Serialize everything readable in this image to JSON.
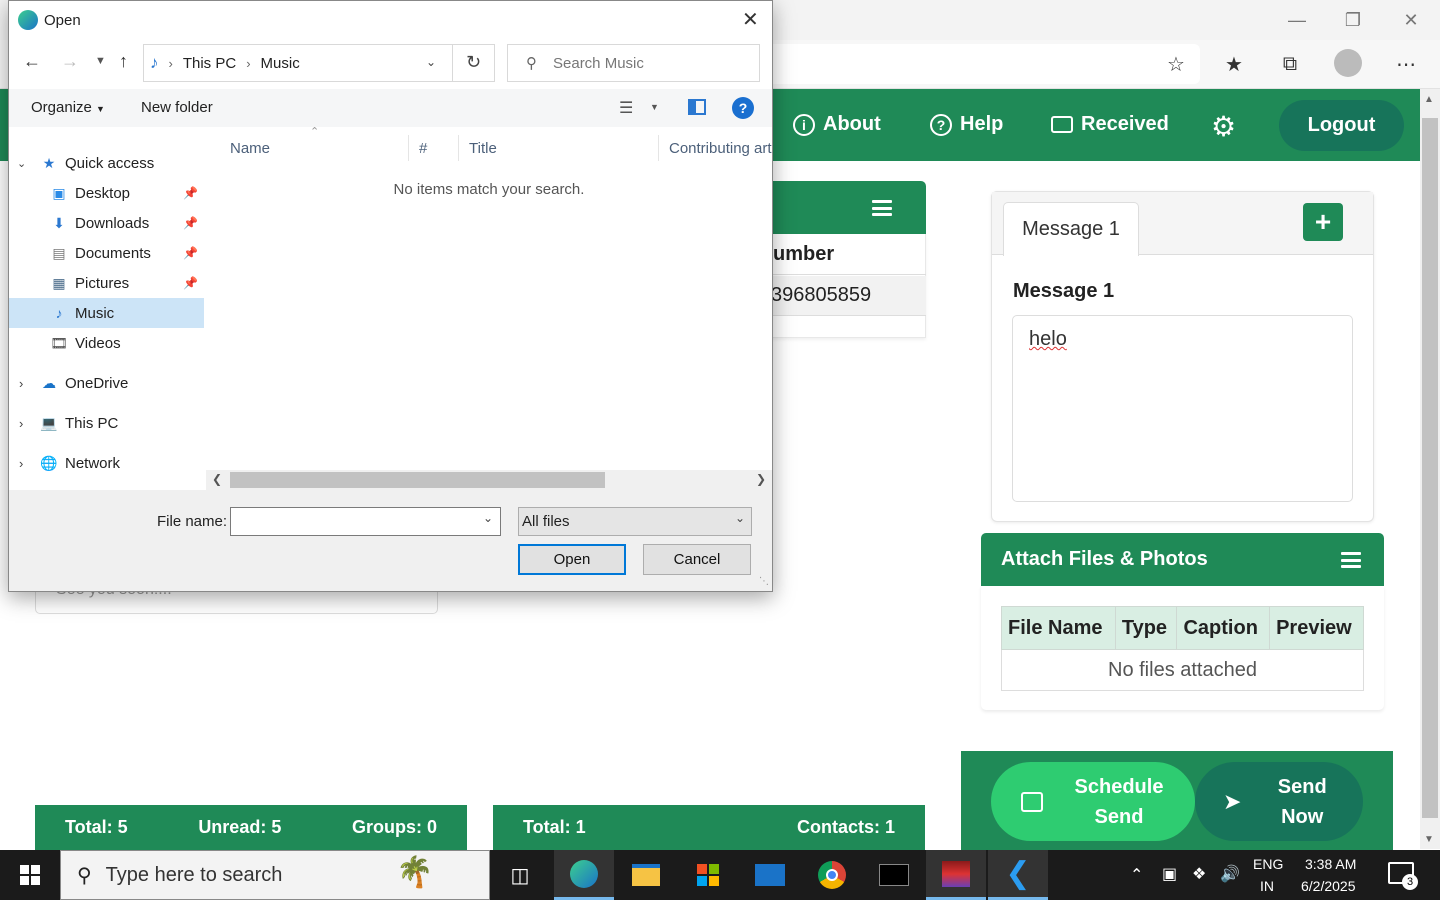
{
  "dialog": {
    "title": "Open",
    "address": {
      "path": [
        "This PC",
        "Music"
      ]
    },
    "search_placeholder": "Search Music",
    "toolbar": {
      "organize": "Organize",
      "new_folder": "New folder"
    },
    "tree": {
      "quick_access": "Quick access",
      "items": [
        "Desktop",
        "Downloads",
        "Documents",
        "Pictures",
        "Music",
        "Videos"
      ],
      "onedrive": "OneDrive",
      "this_pc": "This PC",
      "network": "Network"
    },
    "columns": [
      "Name",
      "#",
      "Title",
      "Contributing art"
    ],
    "empty_message": "No items match your search.",
    "file_name_label": "File name:",
    "file_name_value": "",
    "file_type": "All files",
    "open_button": "Open",
    "cancel_button": "Cancel"
  },
  "app_nav": {
    "about": "About",
    "help": "Help",
    "received": "Received",
    "logout": "Logout"
  },
  "contacts": {
    "column_partial": "umber",
    "number_partial": "396805859"
  },
  "message": {
    "tab": "Message 1",
    "label": "Message 1",
    "text": "helo"
  },
  "attach": {
    "title": "Attach Files & Photos",
    "columns": [
      "File Name",
      "Type",
      "Caption",
      "Preview"
    ],
    "empty": "No files attached"
  },
  "send": {
    "schedule": [
      "Schedule",
      "Send"
    ],
    "now": [
      "Send",
      "Now"
    ]
  },
  "background_input_partial": "See you soon!...",
  "stats_left": {
    "total": "Total: 5",
    "unread": "Unread: 5",
    "groups": "Groups: 0"
  },
  "stats_right": {
    "total": "Total: 1",
    "contacts": "Contacts: 1"
  },
  "taskbar": {
    "search_placeholder": "Type here to search",
    "lang_top": "ENG",
    "lang_bottom": "IN",
    "time": "3:38 AM",
    "date": "6/2/2025",
    "notif_count": "3"
  },
  "colors": {
    "brand_green": "#1f8a57",
    "dark_teal": "#17745a",
    "light_green": "#2ecc71"
  }
}
